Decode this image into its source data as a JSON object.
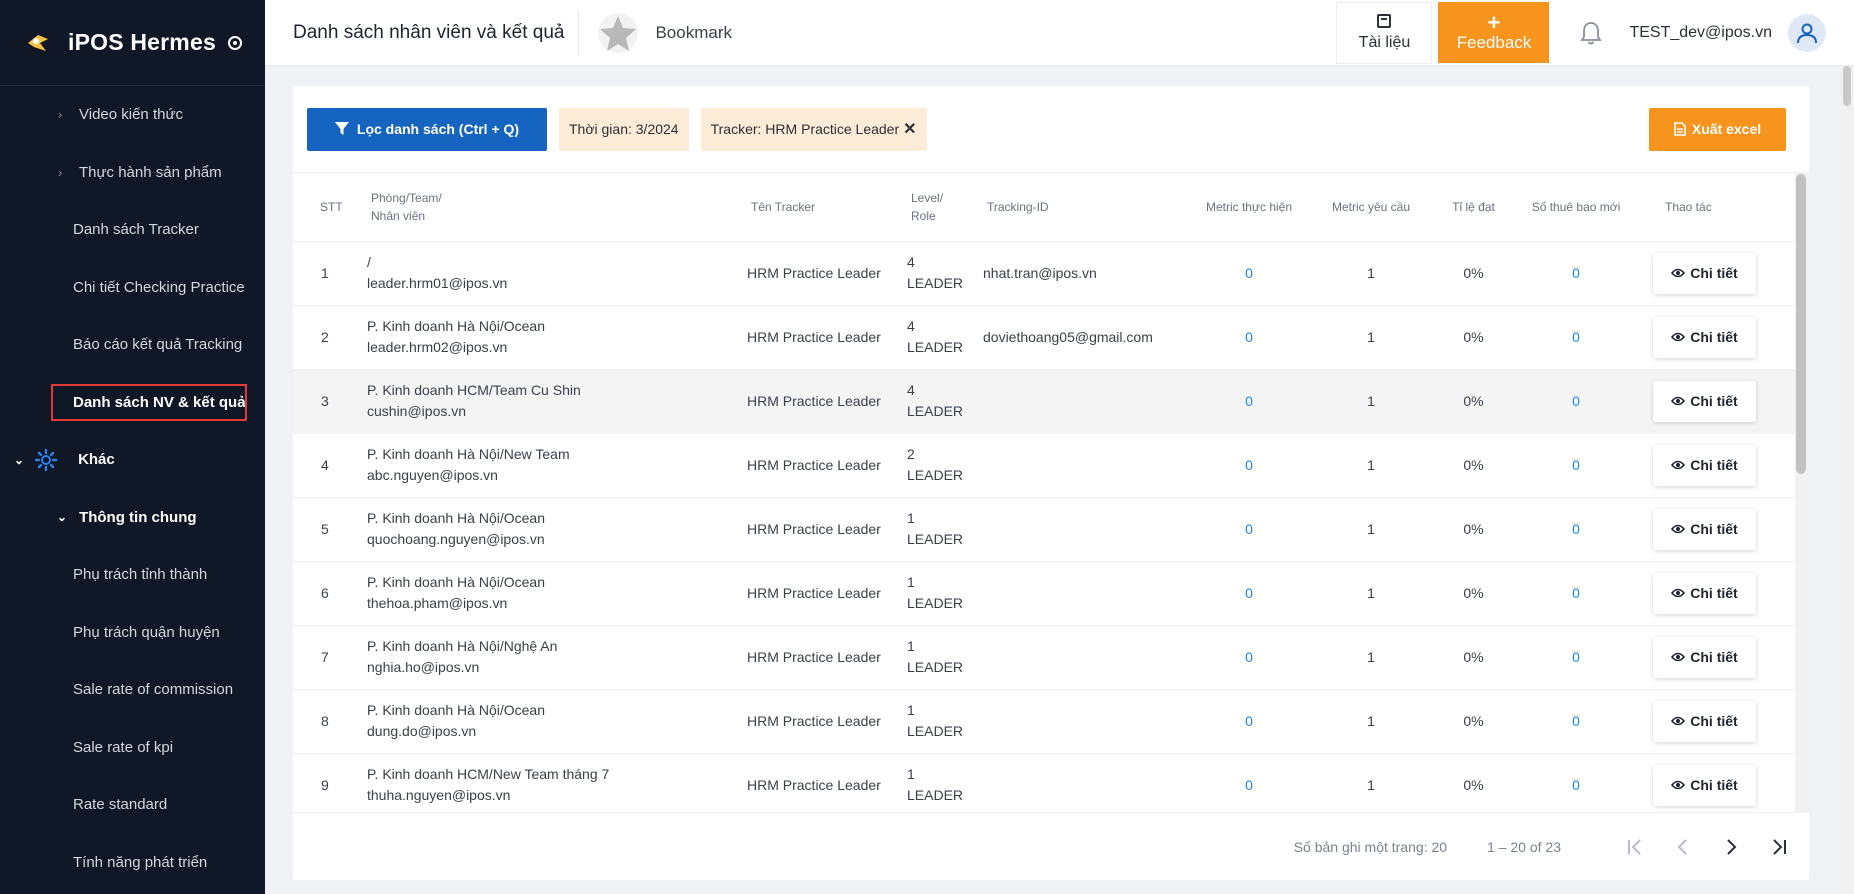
{
  "app": {
    "brand": "iPOS Hermes"
  },
  "sidebar": {
    "items": [
      {
        "label": "Video kiến thức"
      },
      {
        "label": "Thực hành sản phẩm"
      },
      {
        "label": "Danh sách Tracker"
      },
      {
        "label": "Chi tiết Checking Practice"
      },
      {
        "label": "Báo cáo kết quả Tracking"
      },
      {
        "label": "Danh sách NV & kết quả"
      },
      {
        "label": "Khác"
      },
      {
        "label": "Thông tin chung"
      },
      {
        "label": "Phụ trách tỉnh thành"
      },
      {
        "label": "Phụ trách quận huyện"
      },
      {
        "label": "Sale rate of commission"
      },
      {
        "label": "Sale rate of kpi"
      },
      {
        "label": "Rate standard"
      },
      {
        "label": "Tính năng phát triển"
      }
    ]
  },
  "header": {
    "title": "Danh sách nhân viên và kết quả",
    "bookmark": "Bookmark",
    "docs": "Tài liệu",
    "feedback": "Feedback",
    "user_email": "TEST_dev@ipos.vn"
  },
  "toolbar": {
    "filter_label": "Lọc danh sách (Ctrl + Q)",
    "chip_time": "Thời gian: 3/2024",
    "chip_tracker": "Tracker: HRM Practice Leader",
    "export_label": "Xuất excel"
  },
  "table": {
    "headers": {
      "stt": "STT",
      "team_1": "Phòng/Team/",
      "team_2": "Nhân viên",
      "tracker": "Tên Tracker",
      "level_1": "Level/",
      "level_2": "Role",
      "tracking_id": "Tracking-ID",
      "metric_done": "Metric thực hiện",
      "metric_req": "Metric yêu cầu",
      "rate": "Tỉ lệ đạt",
      "new_subs": "Số thuê bao mới",
      "action": "Thao tác"
    },
    "detail_label": "Chi tiết",
    "rows": [
      {
        "stt": "1",
        "team": "/",
        "email": "leader.hrm01@ipos.vn",
        "tracker": "HRM Practice Leader",
        "level": "4",
        "role": "LEADER",
        "tracking_id": "nhat.tran@ipos.vn",
        "metric_done": "0",
        "metric_req": "1",
        "rate": "0%",
        "new_subs": "0"
      },
      {
        "stt": "2",
        "team": "P. Kinh doanh Hà Nội/Ocean",
        "email": "leader.hrm02@ipos.vn",
        "tracker": "HRM Practice Leader",
        "level": "4",
        "role": "LEADER",
        "tracking_id": "doviethoang05@gmail.com",
        "metric_done": "0",
        "metric_req": "1",
        "rate": "0%",
        "new_subs": "0"
      },
      {
        "stt": "3",
        "team": "P. Kinh doanh HCM/Team Cu Shin",
        "email": "cushin@ipos.vn",
        "tracker": "HRM Practice Leader",
        "level": "4",
        "role": "LEADER",
        "tracking_id": "",
        "metric_done": "0",
        "metric_req": "1",
        "rate": "0%",
        "new_subs": "0"
      },
      {
        "stt": "4",
        "team": "P. Kinh doanh Hà Nội/New Team",
        "email": "abc.nguyen@ipos.vn",
        "tracker": "HRM Practice Leader",
        "level": "2",
        "role": "LEADER",
        "tracking_id": "",
        "metric_done": "0",
        "metric_req": "1",
        "rate": "0%",
        "new_subs": "0"
      },
      {
        "stt": "5",
        "team": "P. Kinh doanh Hà Nội/Ocean",
        "email": "quochoang.nguyen@ipos.vn",
        "tracker": "HRM Practice Leader",
        "level": "1",
        "role": "LEADER",
        "tracking_id": "",
        "metric_done": "0",
        "metric_req": "1",
        "rate": "0%",
        "new_subs": "0"
      },
      {
        "stt": "6",
        "team": "P. Kinh doanh Hà Nội/Ocean",
        "email": "thehoa.pham@ipos.vn",
        "tracker": "HRM Practice Leader",
        "level": "1",
        "role": "LEADER",
        "tracking_id": "",
        "metric_done": "0",
        "metric_req": "1",
        "rate": "0%",
        "new_subs": "0"
      },
      {
        "stt": "7",
        "team": "P. Kinh doanh Hà Nội/Nghệ An",
        "email": "nghia.ho@ipos.vn",
        "tracker": "HRM Practice Leader",
        "level": "1",
        "role": "LEADER",
        "tracking_id": "",
        "metric_done": "0",
        "metric_req": "1",
        "rate": "0%",
        "new_subs": "0"
      },
      {
        "stt": "8",
        "team": "P. Kinh doanh Hà Nội/Ocean",
        "email": "dung.do@ipos.vn",
        "tracker": "HRM Practice Leader",
        "level": "1",
        "role": "LEADER",
        "tracking_id": "",
        "metric_done": "0",
        "metric_req": "1",
        "rate": "0%",
        "new_subs": "0"
      },
      {
        "stt": "9",
        "team": "P. Kinh doanh HCM/New Team tháng 7",
        "email": "thuha.nguyen@ipos.vn",
        "tracker": "HRM Practice Leader",
        "level": "1",
        "role": "LEADER",
        "tracking_id": "",
        "metric_done": "0",
        "metric_req": "1",
        "rate": "0%",
        "new_subs": "0"
      }
    ]
  },
  "pager": {
    "per_page": "Số bản ghi một trang: 20",
    "range": "1 – 20 of 23"
  }
}
